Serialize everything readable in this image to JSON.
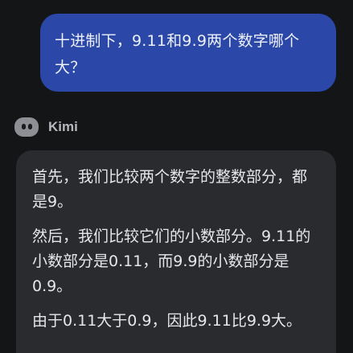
{
  "conversation": {
    "user_message": "十进制下，9.11和9.9两个数字哪个大？",
    "assistant": {
      "name": "Kimi",
      "avatar_icon": "kimi-avatar-icon",
      "paragraphs": [
        "首先，我们比较两个数字的整数部分，都是9。",
        "然后，我们比较它们的小数部分。9.11的小数部分是0.11，而9.9的小数部分是0.9。",
        "由于0.11大于0.9，因此9.11比9.9大。"
      ]
    }
  },
  "colors": {
    "background": "#141517",
    "user_bubble": "#2b48a8",
    "assistant_bubble": "#2a2b2f"
  }
}
